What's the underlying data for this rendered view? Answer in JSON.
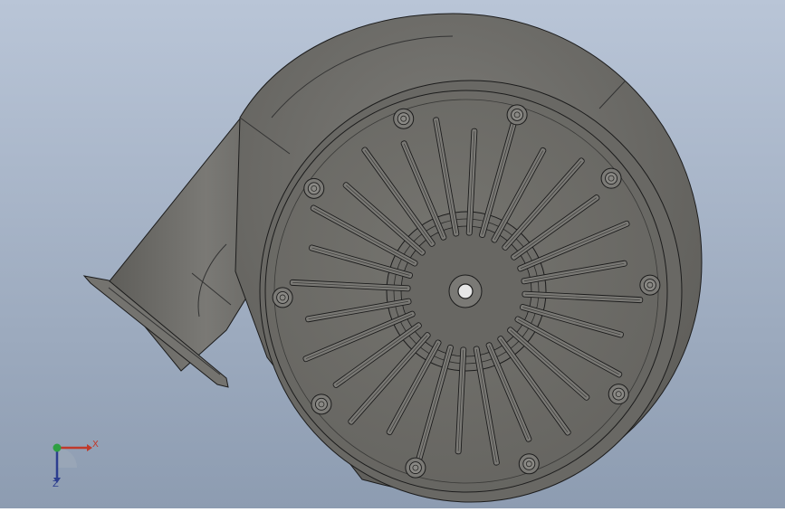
{
  "viewport": {
    "background_top": "#b7c3d6",
    "background_bottom": "#8e9db2",
    "model_color": "#6b6a66",
    "edge_color": "#1c1c1c"
  },
  "triad": {
    "x_label": "X",
    "z_label": "Z",
    "x_color": "#c0392b",
    "z_color": "#2c3e8f",
    "y_color": "#2ea043"
  }
}
